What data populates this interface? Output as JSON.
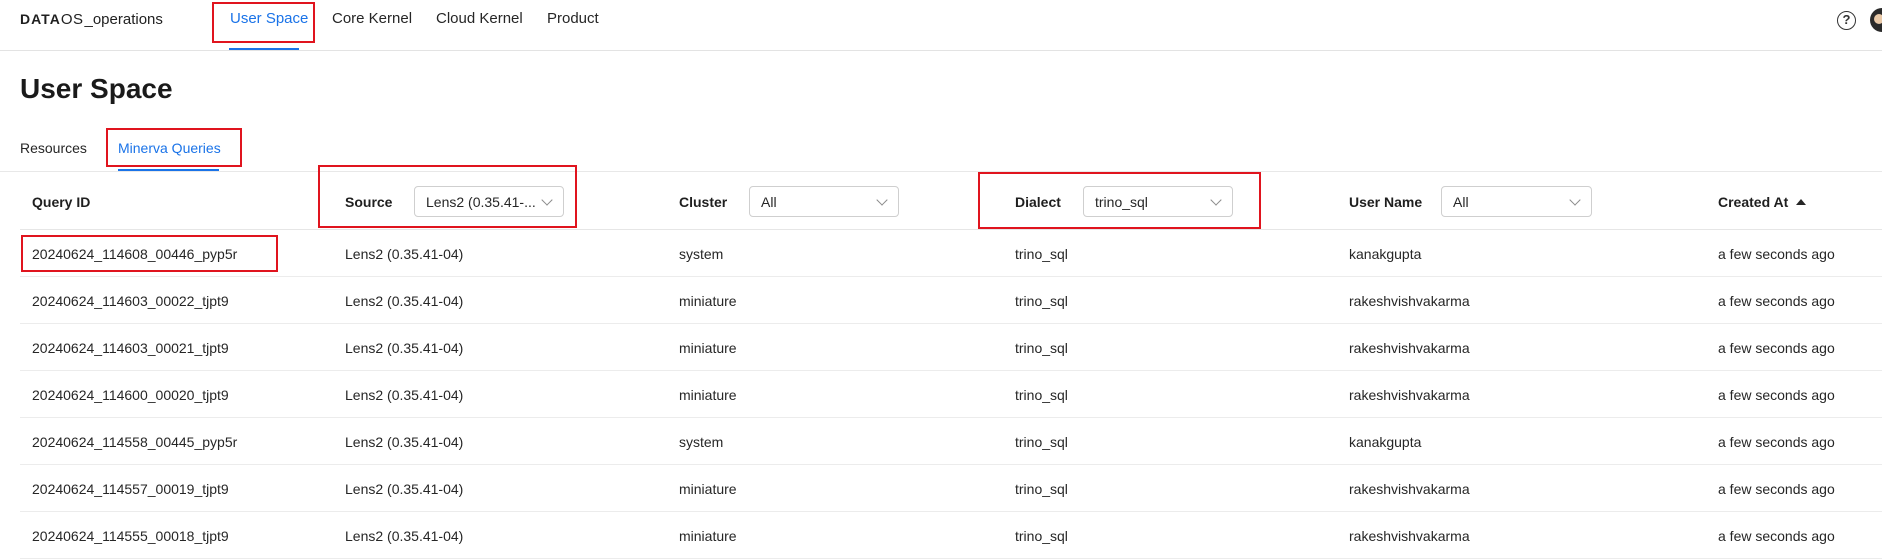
{
  "brand": {
    "logo_main": "DATA",
    "logo_os": "OS",
    "workspace": "_operations"
  },
  "nav": {
    "items": [
      {
        "label": "User Space",
        "active": true
      },
      {
        "label": "Core Kernel",
        "active": false
      },
      {
        "label": "Cloud Kernel",
        "active": false
      },
      {
        "label": "Product",
        "active": false
      }
    ],
    "help_glyph": "?",
    "accent_color": "#1a73e8"
  },
  "page": {
    "title": "User Space"
  },
  "subtabs": [
    {
      "label": "Resources",
      "active": false
    },
    {
      "label": "Minerva Queries",
      "active": true
    }
  ],
  "table": {
    "columns": {
      "query_id": "Query ID",
      "source": "Source",
      "cluster": "Cluster",
      "dialect": "Dialect",
      "user_name": "User Name",
      "created_at": "Created At"
    },
    "filters": {
      "source": "Lens2 (0.35.41-...",
      "cluster": "All",
      "dialect": "trino_sql",
      "user_name": "All"
    },
    "sort": {
      "column": "Created At",
      "direction": "ascending"
    },
    "rows": [
      {
        "query_id": "20240624_114608_00446_pyp5r",
        "source": "Lens2 (0.35.41-04)",
        "cluster": "system",
        "dialect": "trino_sql",
        "user": "kanakgupta",
        "created": "a few seconds ago"
      },
      {
        "query_id": "20240624_114603_00022_tjpt9",
        "source": "Lens2 (0.35.41-04)",
        "cluster": "miniature",
        "dialect": "trino_sql",
        "user": "rakeshvishvakarma",
        "created": "a few seconds ago"
      },
      {
        "query_id": "20240624_114603_00021_tjpt9",
        "source": "Lens2 (0.35.41-04)",
        "cluster": "miniature",
        "dialect": "trino_sql",
        "user": "rakeshvishvakarma",
        "created": "a few seconds ago"
      },
      {
        "query_id": "20240624_114600_00020_tjpt9",
        "source": "Lens2 (0.35.41-04)",
        "cluster": "miniature",
        "dialect": "trino_sql",
        "user": "rakeshvishvakarma",
        "created": "a few seconds ago"
      },
      {
        "query_id": "20240624_114558_00445_pyp5r",
        "source": "Lens2 (0.35.41-04)",
        "cluster": "system",
        "dialect": "trino_sql",
        "user": "kanakgupta",
        "created": "a few seconds ago"
      },
      {
        "query_id": "20240624_114557_00019_tjpt9",
        "source": "Lens2 (0.35.41-04)",
        "cluster": "miniature",
        "dialect": "trino_sql",
        "user": "rakeshvishvakarma",
        "created": "a few seconds ago"
      },
      {
        "query_id": "20240624_114555_00018_tjpt9",
        "source": "Lens2 (0.35.41-04)",
        "cluster": "miniature",
        "dialect": "trino_sql",
        "user": "rakeshvishvakarma",
        "created": "a few seconds ago"
      }
    ]
  },
  "annotation_color": "#e0141e"
}
